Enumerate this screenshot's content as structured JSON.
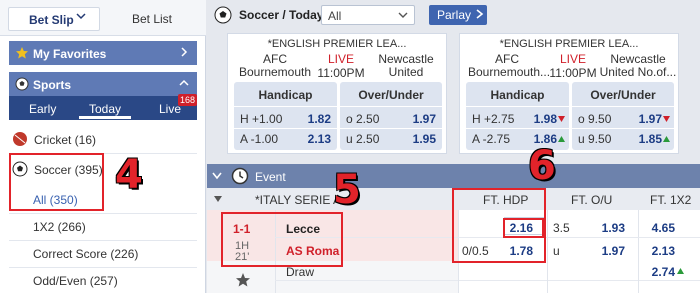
{
  "sidebar": {
    "tab_betslip": "Bet Slip",
    "tab_betlist": "Bet List",
    "favorites": "My Favorites",
    "sports": "Sports",
    "subtabs": {
      "early": "Early",
      "today": "Today",
      "live": "Live",
      "live_count": "168"
    },
    "cricket": "Cricket (16)",
    "soccer": "Soccer (395)",
    "soccer_subs": [
      "All (350)",
      "1X2 (266)",
      "Correct Score (226)",
      "Odd/Even (257)"
    ]
  },
  "header": {
    "title": "Soccer / Today",
    "select_value": "All",
    "parlay": "Parlay"
  },
  "cards": [
    {
      "league": "*ENGLISH PREMIER LEA...",
      "home": [
        "AFC",
        "Bournemouth"
      ],
      "status": "LIVE",
      "time": "11:00PM",
      "away": [
        "Newcastle",
        "United"
      ],
      "handicap_label": "Handicap",
      "ou_label": "Over/Under",
      "hdp": [
        {
          "line": "H +1.00",
          "odd": "1.82"
        },
        {
          "line": "A -1.00",
          "odd": "2.13"
        }
      ],
      "ou": [
        {
          "line": "o 2.50",
          "odd": "1.97"
        },
        {
          "line": "u 2.50",
          "odd": "1.95"
        }
      ]
    },
    {
      "league": "*ENGLISH PREMIER LEA...",
      "home": [
        "AFC",
        "Bournemouth..."
      ],
      "status": "LIVE",
      "time": "11:00PM",
      "away": [
        "Newcastle",
        "United No.of..."
      ],
      "handicap_label": "Handicap",
      "ou_label": "Over/Under",
      "hdp": [
        {
          "line": "H +2.75",
          "odd": "1.98",
          "trend": "down"
        },
        {
          "line": "A -2.75",
          "odd": "1.86",
          "trend": "up"
        }
      ],
      "ou": [
        {
          "line": "o 9.50",
          "odd": "1.97",
          "trend": "down"
        },
        {
          "line": "u 9.50",
          "odd": "1.85",
          "trend": "up"
        }
      ]
    }
  ],
  "event": {
    "label": "Event",
    "league": "*ITALY SERIE A",
    "cols": [
      "FT. HDP",
      "FT. O/U",
      "FT. 1X2"
    ],
    "match": {
      "score": "1-1",
      "period": "1H",
      "minute": "21'",
      "home": "Lecce",
      "away": "AS Roma",
      "draw": "Draw",
      "hdp_line": "0/0.5",
      "hdp_home": "2.16",
      "hdp_away": "1.78",
      "ou_line": "3.5",
      "ou_u": "u",
      "ou_over": "1.93",
      "ou_under": "1.97",
      "x12_home": "4.65",
      "x12_away": "2.13",
      "x12_draw": "2.74"
    }
  },
  "annotations": [
    "4",
    "5",
    "6"
  ],
  "colors": {
    "accent": "#e2232a",
    "bar": "#5f7ab5",
    "nav": "#2a4886",
    "odds": "#1c3c84",
    "live": "#d0202a"
  }
}
